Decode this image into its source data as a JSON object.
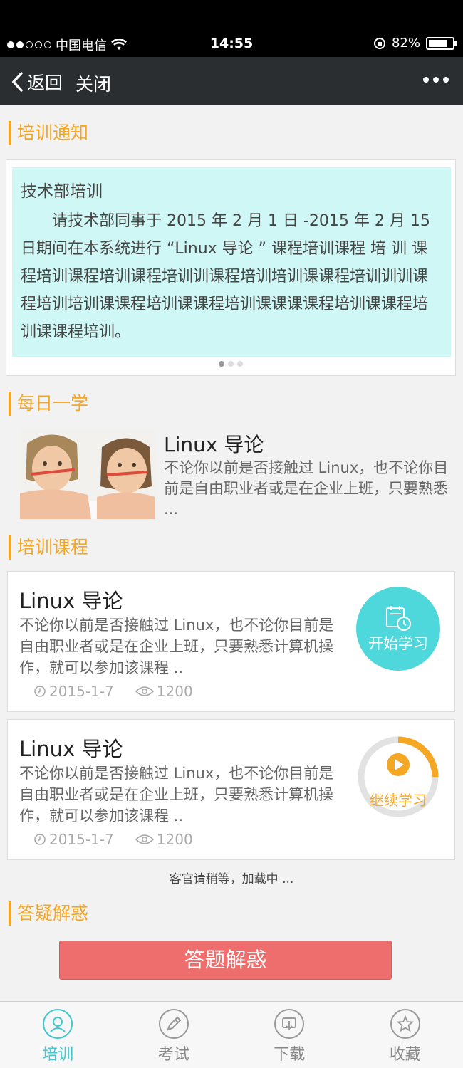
{
  "status_bar": {
    "carrier": "中国电信",
    "time": "14:55",
    "battery": "82%"
  },
  "nav": {
    "back_label": "返回",
    "close_label": "关闭"
  },
  "sections": {
    "notice": "培训通知",
    "daily": "每日一学",
    "courses": "培训课程",
    "qa": "答疑解惑"
  },
  "notice": {
    "title": "技术部培训",
    "body": "请技术部同事于 2015 年 2 月 1 日 -2015 年 2 月 15 日期间在本系统进行 “Linux 导论 ” 课程培训课程 培 训 课 程培训课程培训课程培训训课程培训培训课课程培训训训课程培训培训课课程培训课课程培训课课课课程培训课课程培训课课程培训。"
  },
  "daily": {
    "title": "Linux 导论",
    "desc": "不论你以前是否接触过 Linux，也不论你目前是自由职业者或是在企业上班，只要熟悉 ..."
  },
  "courses": [
    {
      "title": "Linux 导论",
      "desc": "不论你以前是否接触过 Linux，也不论你目前是自由职业者或是在企业上班，只要熟悉计算机操作，就可以参加该课程 ..",
      "date": "2015-1-7",
      "views": "1200",
      "action": "开始学习"
    },
    {
      "title": "Linux 导论",
      "desc": "不论你以前是否接触过 Linux，也不论你目前是自由职业者或是在企业上班，只要熟悉计算机操作，就可以参加该课程 ..",
      "date": "2015-1-7",
      "views": "1200",
      "action": "继续学习",
      "progress": 0.25
    }
  ],
  "loading_text": "客官请稍等，加载中 ...",
  "qa_button": "答题解惑",
  "tabs": [
    {
      "label": "培训",
      "icon": "user-icon",
      "active": true
    },
    {
      "label": "考试",
      "icon": "pencil-icon",
      "active": false
    },
    {
      "label": "下载",
      "icon": "download-icon",
      "active": false
    },
    {
      "label": "收藏",
      "icon": "star-icon",
      "active": false
    }
  ],
  "colors": {
    "accent": "#f5a623",
    "teal": "#4fd8dc",
    "qa_button": "#ee6d6d",
    "nav_bg": "#2a2e31"
  }
}
